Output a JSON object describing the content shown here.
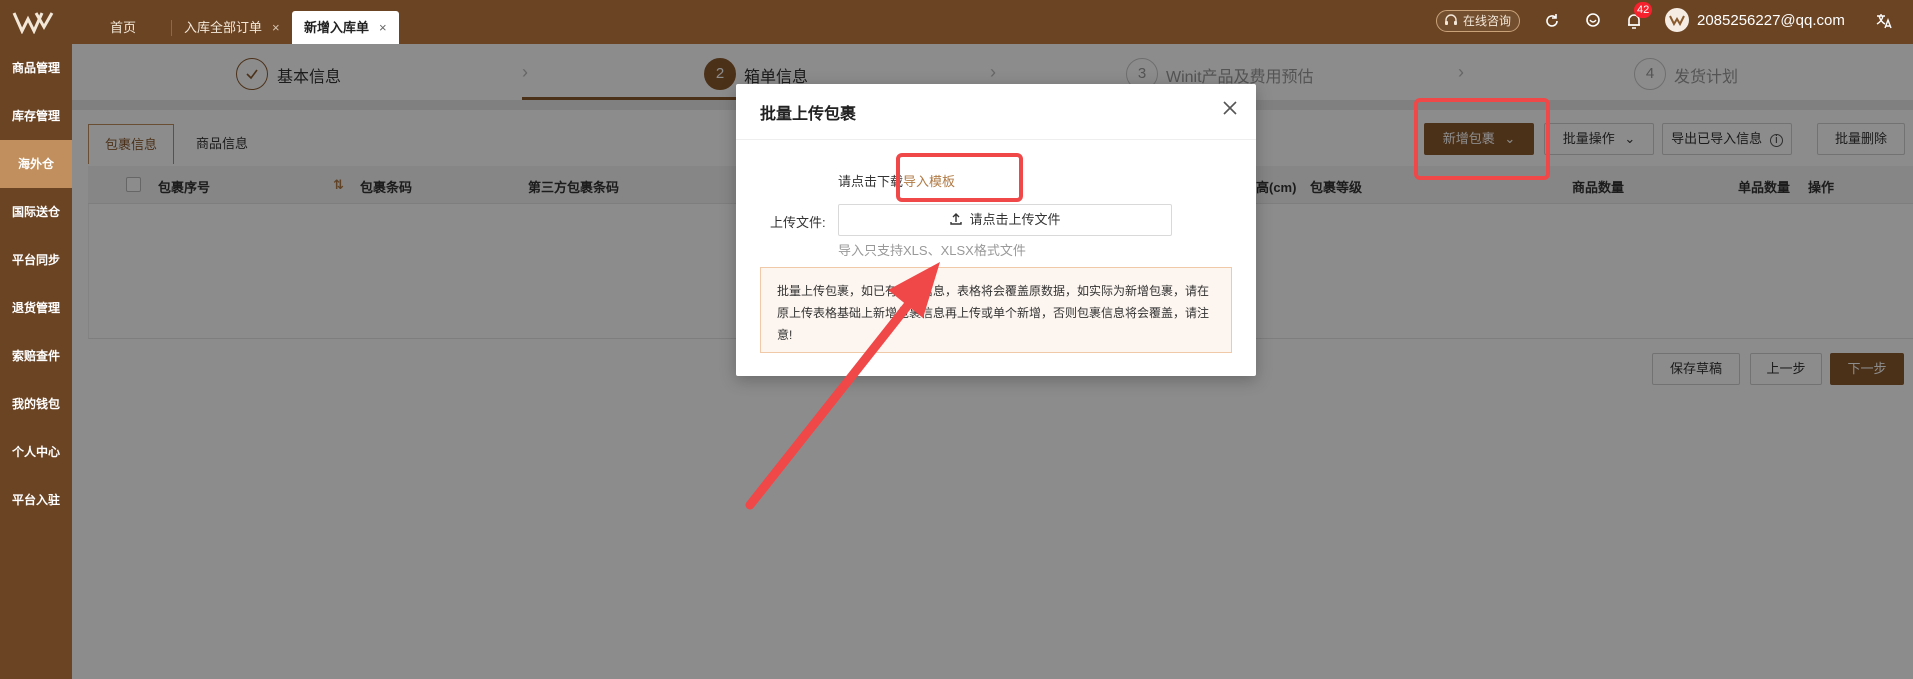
{
  "topbar": {
    "tabs": [
      {
        "label": "首页",
        "closable": false,
        "active": false
      },
      {
        "label": "入库全部订单",
        "closable": true,
        "active": false
      },
      {
        "label": "新增入库单",
        "closable": true,
        "active": true
      }
    ],
    "close_glyph": "×",
    "online_consult": "在线咨询",
    "notification_count": "42",
    "user_email": "2085256227@qq.com",
    "icons": [
      "logo-icon",
      "headset-icon",
      "refresh-icon",
      "location-icon",
      "bell-icon",
      "translate-icon"
    ]
  },
  "sidebar": {
    "items": [
      {
        "label": "商品管理"
      },
      {
        "label": "库存管理"
      },
      {
        "label": "海外仓",
        "active": true
      },
      {
        "label": "国际送仓"
      },
      {
        "label": "平台同步"
      },
      {
        "label": "退货管理"
      },
      {
        "label": "索赔查件"
      },
      {
        "label": "我的钱包"
      },
      {
        "label": "个人中心"
      },
      {
        "label": "平台入驻"
      }
    ]
  },
  "steps": [
    {
      "number": "",
      "label": "基本信息",
      "state": "done"
    },
    {
      "number": "2",
      "label": "箱单信息",
      "state": "current"
    },
    {
      "number": "3",
      "label": "Winit产品及费用预估",
      "state": "future"
    },
    {
      "number": "4",
      "label": "发货计划",
      "state": "future"
    }
  ],
  "content": {
    "tabs": [
      "包裹信息",
      "商品信息"
    ],
    "actions": {
      "add_package": "新增包裹",
      "batch_ops": "批量操作",
      "export_imported": "导出已导入信息",
      "batch_delete": "批量删除"
    },
    "columns": [
      "包裹序号",
      "包裹条码",
      "第三方包裹条码",
      "高(cm)",
      "包裹等级",
      "商品数量",
      "单品数量",
      "操作"
    ],
    "footer": {
      "save_draft": "保存草稿",
      "prev": "上一步",
      "next": "下一步"
    }
  },
  "modal": {
    "title": "批量上传包裹",
    "download_prefix": "请点击下载",
    "download_link": "导入模板",
    "upload_label": "上传文件:",
    "upload_button": "请点击上传文件",
    "hint": "导入只支持XLS、XLSX格式文件",
    "warning": "批量上传包裹，如已有包裹信息，表格将会覆盖原数据，如实际为新增包裹，请在原上传表格基础上新增包裹信息再上传或单个新增，否则包裹信息将会覆盖，请注意!"
  },
  "colors": {
    "brand_dark": "#6b4424",
    "brand": "#8a5a2f",
    "brand_light": "#c18e5d",
    "annotation_red": "#f04848"
  }
}
